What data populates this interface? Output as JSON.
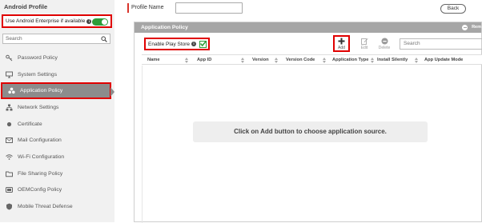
{
  "sidebar": {
    "title": "Android Profile",
    "enterprise_toggle_label": "Use Android Enterprise if available",
    "enterprise_info": "i",
    "search_placeholder": "Search",
    "items": [
      {
        "label": "Password Policy",
        "icon": "key-icon"
      },
      {
        "label": "System Settings",
        "icon": "monitor-icon"
      },
      {
        "label": "Application Policy",
        "icon": "apps-icon",
        "active": true
      },
      {
        "label": "Network Settings",
        "icon": "network-icon"
      },
      {
        "label": "Certificate",
        "icon": "certificate-icon"
      },
      {
        "label": "Mail Configuration",
        "icon": "mail-icon"
      },
      {
        "label": "Wi-Fi Configuration",
        "icon": "wifi-icon"
      },
      {
        "label": "File Sharing Policy",
        "icon": "folder-icon"
      },
      {
        "label": "OEMConfig Policy",
        "icon": "oemconfig-icon"
      },
      {
        "label": "Mobile Threat Defense",
        "icon": "shield-icon"
      }
    ]
  },
  "header": {
    "profile_name_label": "Profile Name",
    "profile_name_value": "",
    "back_label": "Back"
  },
  "panel": {
    "title": "Application Policy",
    "header_right_label": "Rem",
    "play_store_label": "Enable Play Store",
    "play_store_info": "i",
    "play_store_checked": true,
    "actions": {
      "add_label": "Add",
      "edit_label": "Edit",
      "delete_label": "Delete"
    },
    "search_placeholder": "Search",
    "columns": [
      "Name",
      "App ID",
      "Version",
      "Version Code",
      "Application Type",
      "Install Silently",
      "App Update Mode"
    ],
    "empty_message": "Click on Add button to choose application source."
  },
  "colors": {
    "accent_green": "#2e9e3a",
    "highlight_red": "#e00000",
    "panel_header": "#a6a6a6",
    "active_item": "#8c8c8c"
  }
}
